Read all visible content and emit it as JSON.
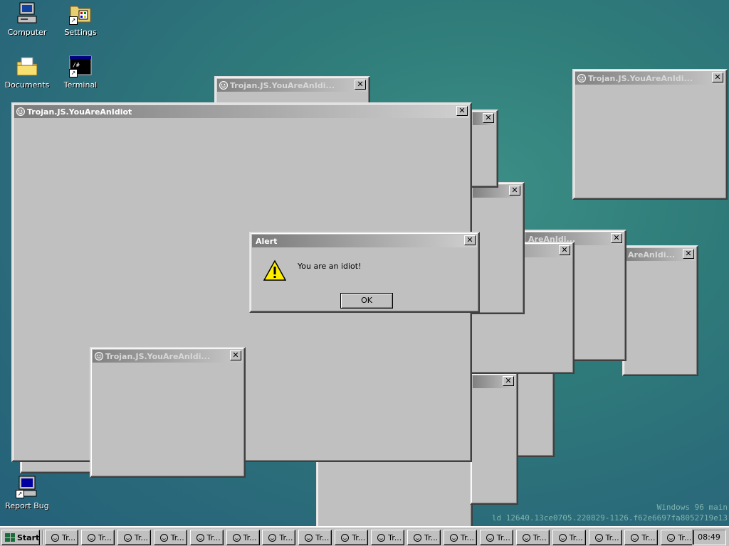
{
  "desktop": {
    "icons": [
      {
        "label": "Computer",
        "icon": "computer-icon"
      },
      {
        "label": "Settings",
        "icon": "settings-icon"
      },
      {
        "label": "Documents",
        "icon": "folder-icon"
      },
      {
        "label": "Terminal",
        "icon": "terminal-icon"
      },
      {
        "label": "Report Bug",
        "icon": "report-bug-icon"
      }
    ],
    "watermark": {
      "line1": "Windows 96 main",
      "line2": "ld 12640.13ce0705.220829-1126.f62e6697fa8052719e13"
    }
  },
  "windows": {
    "main_title": "Trojan.JS.YouAreAnIdiot",
    "truncated_title": "Trojan.JS.YouAreAnIdi...",
    "partial_title": "AreAnIdi...",
    "partial_title_2": "...AreAnIdi...",
    "close_label": "✕"
  },
  "alert": {
    "title": "Alert",
    "message": "You are an idiot!",
    "ok_label": "OK"
  },
  "taskbar": {
    "start_label": "Start",
    "task_label": "Tr...",
    "task_count": 18,
    "clock": "08:49"
  },
  "colors": {
    "desktop": "#2f7c7a",
    "window_face": "#c0c0c0",
    "titlebar_start": "#808080",
    "titlebar_end": "#c8c8c8"
  }
}
